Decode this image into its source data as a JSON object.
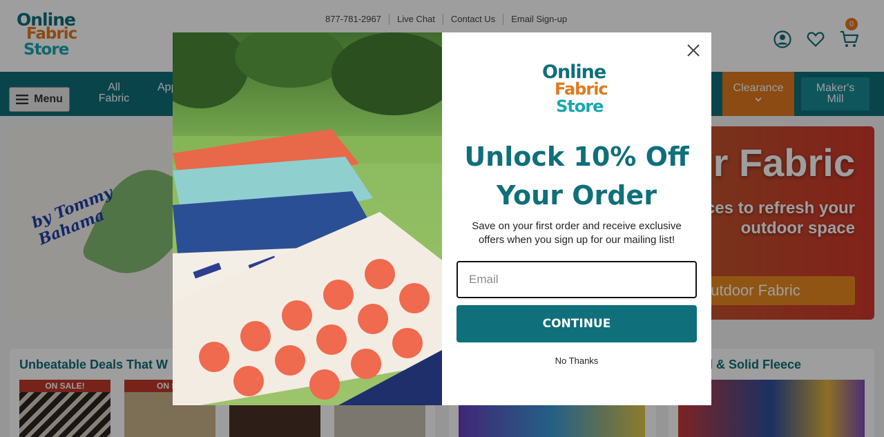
{
  "header": {
    "logo": {
      "line1": "Online",
      "line2": "Fabric",
      "line3": "Store"
    },
    "topbar": [
      "877-781-2967",
      "Live Chat",
      "Contact Us",
      "Email Sign-up"
    ],
    "cart_count": "0",
    "icons": [
      "account-icon",
      "heart-icon",
      "cart-icon"
    ]
  },
  "nav": {
    "menu_label": "Menu",
    "items": [
      {
        "line1": "All",
        "line2": "Fabric"
      },
      {
        "line1": "App",
        "line2": ""
      }
    ],
    "clearance": "Clearance",
    "maker_line1": "Maker's",
    "maker_line2": "Mill"
  },
  "hero": {
    "brand": "by Tommy Bahama",
    "title": "r Fabric",
    "subtitle": "ces to refresh your outdoor space",
    "cta": "Outdoor Fabric"
  },
  "deals": {
    "title": "Unbeatable Deals That W",
    "badges": [
      "ON SALE!",
      "ON SA",
      "",
      ""
    ]
  },
  "fleece": {
    "title": "rinted & Solid Fleece"
  },
  "modal": {
    "logo": {
      "line1": "Online",
      "line2": "Fabric",
      "line3": "Store"
    },
    "headline": "Unlock 10% Off Your Order",
    "description": "Save on your first order and receive exclusive offers when you sign up for our mailing list!",
    "email_placeholder": "Email",
    "continue_label": "CONTINUE",
    "no_thanks": "No Thanks"
  },
  "colors": {
    "brand_teal": "#0f6f7a",
    "brand_orange": "#e07a1f",
    "brand_aqua": "#18a8b0"
  }
}
